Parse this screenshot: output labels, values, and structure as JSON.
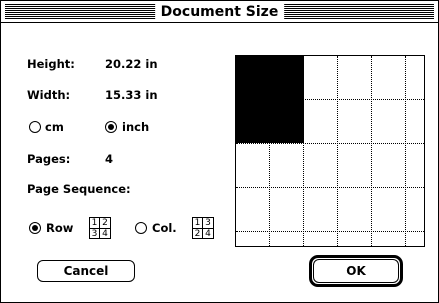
{
  "dialog": {
    "title": "Document Size",
    "height_label": "Height:",
    "height_value": "20.22 in",
    "width_label": "Width:",
    "width_value": "15.33 in",
    "units": {
      "cm_label": "cm",
      "inch_label": "inch",
      "selected": "inch"
    },
    "pages_label": "Pages:",
    "pages_value": "4",
    "sequence_label": "Page Sequence:",
    "sequence": {
      "row_label": "Row",
      "col_label": "Col.",
      "selected": "row",
      "row_grid": [
        "1",
        "2",
        "3",
        "4"
      ],
      "col_grid": [
        "1",
        "3",
        "2",
        "4"
      ]
    },
    "buttons": {
      "cancel": "Cancel",
      "ok": "OK"
    }
  }
}
